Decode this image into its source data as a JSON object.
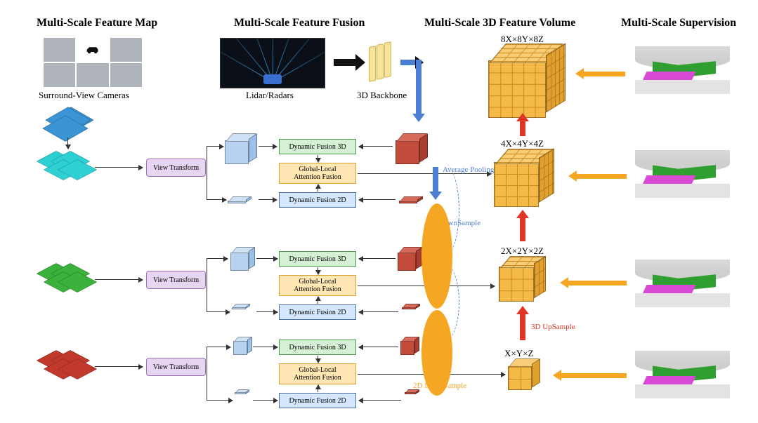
{
  "headings": {
    "feature_map": "Multi-Scale Feature Map",
    "fusion": "Multi-Scale Feature Fusion",
    "volume": "Multi-Scale 3D Feature Volume",
    "supervision": "Multi-Scale Supervision"
  },
  "captions": {
    "cameras": "Surround-View Cameras",
    "lidar": "Lidar/Radars",
    "backbone": "3D Backbone"
  },
  "modules": {
    "view_transform": "View Transform",
    "df3d": "Dynamic Fusion 3D",
    "gla_line1": "Global-Local",
    "gla_line2": "Attention Fusion",
    "df2d": "Dynamic Fusion 2D"
  },
  "annotations": {
    "avg_pooling": "Average Pooling",
    "downsample_3d": "3D DownSample",
    "downsample_2d": "2D DownSample",
    "upsample_3d": "3D UpSample"
  },
  "scales": {
    "s8": "8X×8Y×8Z",
    "s4": "4X×4Y×4Z",
    "s2": "2X×2Y×2Z",
    "s1": "X×Y×Z"
  },
  "colors": {
    "cyan": "#2fd0d4",
    "green": "#2fa02f",
    "red": "#c0392b",
    "orange": "#f5a623",
    "blue": "#4a7fd4",
    "redArrow": "#e03525"
  }
}
